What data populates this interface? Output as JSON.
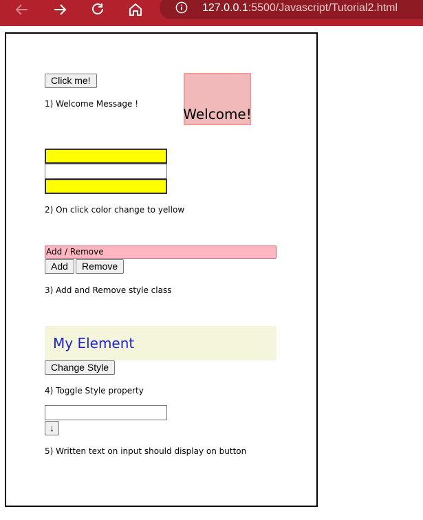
{
  "browser": {
    "url_host": "127.0.0.1",
    "url_path": ":5500/Javascript/Tutorial2.html",
    "icons": [
      "back-arrow-icon",
      "forward-arrow-icon",
      "reload-icon",
      "home-icon",
      "info-icon"
    ],
    "bar_color": "#b3222c"
  },
  "section1": {
    "button_label": "Click me!",
    "caption": "1) Welcome Message !",
    "welcome_text": "Welcome!"
  },
  "section2": {
    "caption": "2) On click color change to yellow",
    "highlight_color": "#ffff00"
  },
  "section3": {
    "input_value": "Add / Remove",
    "add_label": "Add",
    "remove_label": "Remove",
    "caption": "3) Add and Remove style class"
  },
  "section4": {
    "element_text": "My Element",
    "button_label": "Change Style",
    "caption": "4) Toggle Style property"
  },
  "section5": {
    "input_value": "",
    "button_label": "↓",
    "caption": "5) Written text on input should display on button"
  }
}
